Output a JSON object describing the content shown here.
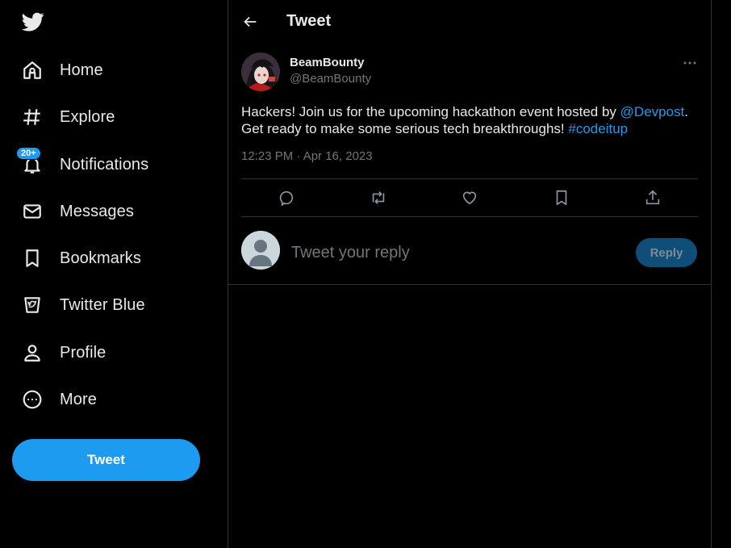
{
  "sidebar": {
    "logo": "twitter-bird-icon",
    "items": [
      {
        "label": "Home",
        "icon": "home-icon"
      },
      {
        "label": "Explore",
        "icon": "hashtag-icon"
      },
      {
        "label": "Notifications",
        "icon": "bell-icon",
        "badge": "20+"
      },
      {
        "label": "Messages",
        "icon": "envelope-icon"
      },
      {
        "label": "Bookmarks",
        "icon": "bookmark-icon"
      },
      {
        "label": "Twitter Blue",
        "icon": "twitter-blue-icon"
      },
      {
        "label": "Profile",
        "icon": "person-icon"
      },
      {
        "label": "More",
        "icon": "more-circle-icon"
      }
    ],
    "tweet_button": "Tweet"
  },
  "header": {
    "title": "Tweet"
  },
  "tweet": {
    "author_name": "BeamBounty",
    "author_handle": "@BeamBounty",
    "text_part1": "Hackers! Join us for the upcoming hackathon event hosted by ",
    "mention": "@Devpost",
    "text_part2": ". Get ready to make some serious tech breakthroughs! ",
    "hashtag": "#codeitup",
    "timestamp": "12:23 PM · Apr 16, 2023",
    "actions": [
      "reply-icon",
      "retweet-icon",
      "like-icon",
      "bookmark-icon",
      "share-icon"
    ]
  },
  "reply": {
    "placeholder": "Tweet your reply",
    "button_label": "Reply"
  },
  "colors": {
    "accent": "#1d9bf0",
    "background": "#000000",
    "text": "#e7e9ea",
    "muted": "#71767b",
    "border": "#2f3336"
  }
}
